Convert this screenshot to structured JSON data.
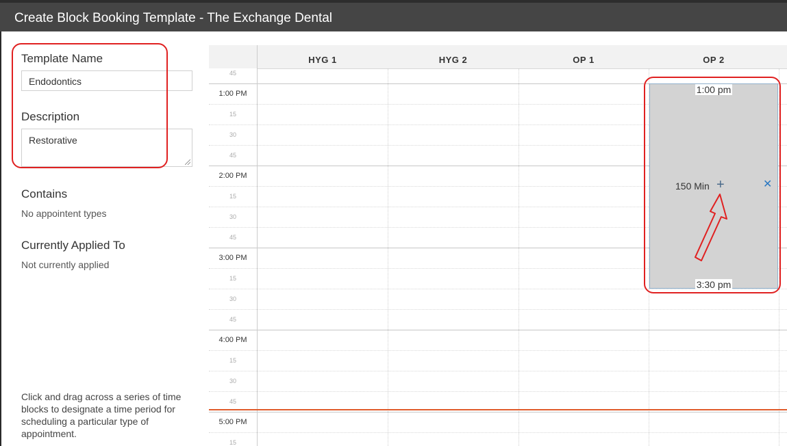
{
  "dialog": {
    "title": "Create Block Booking Template - The Exchange Dental"
  },
  "form": {
    "template_name_label": "Template Name",
    "template_name_value": "Endodontics",
    "description_label": "Description",
    "description_value": "Restorative",
    "contains_label": "Contains",
    "contains_value": "No appointent types",
    "applied_label": "Currently Applied To",
    "applied_value": "Not currently applied",
    "hint": "Click and drag across a series of time blocks to designate a time period for scheduling a particular type of appointment."
  },
  "calendar": {
    "columns": [
      "HYG 1",
      "HYG 2",
      "OP 1",
      "OP 2"
    ],
    "times": [
      "45",
      "1:00 PM",
      "15",
      "30",
      "45",
      "2:00 PM",
      "15",
      "30",
      "45",
      "3:00 PM",
      "15",
      "30",
      "45",
      "4:00 PM",
      "15",
      "30",
      "45",
      "5:00 PM",
      "15"
    ],
    "block": {
      "start": "1:00 pm",
      "end": "3:30 pm",
      "duration": "150 Min",
      "add_icon": "plus-icon",
      "remove_icon": "close-icon"
    }
  },
  "colors": {
    "title_bar": "#454545",
    "annotation": "#e02020",
    "now_line": "#e05a2a",
    "block_fill": "#d3d3d3",
    "remove_icon": "#2a78c2"
  }
}
